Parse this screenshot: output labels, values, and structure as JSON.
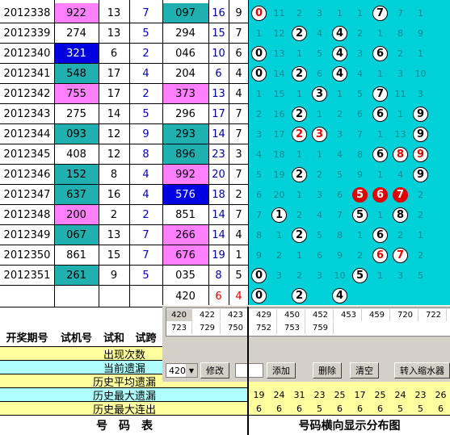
{
  "rows": [
    {
      "period": "2012338",
      "trial": "922",
      "sum": "13",
      "span": "7",
      "num3": "097",
      "s2": "16",
      "k2": "9",
      "dist": [
        "0",
        "11",
        "2",
        "3",
        "1",
        "1",
        "7",
        "7",
        "1"
      ]
    },
    {
      "period": "2012339",
      "trial": "274",
      "sum": "13",
      "span": "5",
      "num3": "294",
      "s2": "15",
      "k2": "7",
      "dist": [
        "1",
        "12",
        "2",
        "4",
        "4",
        "2",
        "1",
        "8",
        "9"
      ]
    },
    {
      "period": "2012340",
      "trial": "321",
      "sum": "6",
      "span": "2",
      "num3": "046",
      "s2": "10",
      "k2": "6",
      "dist": [
        "0",
        "13",
        "1",
        "5",
        "4",
        "3",
        "6",
        "2",
        "1"
      ]
    },
    {
      "period": "2012341",
      "trial": "548",
      "sum": "17",
      "span": "4",
      "num3": "204",
      "s2": "6",
      "k2": "4",
      "dist": [
        "0",
        "14",
        "2",
        "6",
        "4",
        "4",
        "1",
        "3",
        "10"
      ]
    },
    {
      "period": "2012342",
      "trial": "755",
      "sum": "17",
      "span": "2",
      "num3": "373",
      "s2": "13",
      "k2": "4",
      "dist": [
        "1",
        "15",
        "1",
        "3",
        "1",
        "5",
        "7",
        "11",
        "3"
      ]
    },
    {
      "period": "2012343",
      "trial": "275",
      "sum": "14",
      "span": "5",
      "num3": "296",
      "s2": "17",
      "k2": "7",
      "dist": [
        "2",
        "16",
        "2",
        "1",
        "2",
        "6",
        "6",
        "1",
        "9"
      ]
    },
    {
      "period": "2012344",
      "trial": "093",
      "sum": "12",
      "span": "9",
      "num3": "293",
      "s2": "14",
      "k2": "7",
      "dist": [
        "3",
        "17",
        "2",
        "3",
        "3",
        "7",
        "1",
        "13",
        "9"
      ]
    },
    {
      "period": "2012345",
      "trial": "408",
      "sum": "12",
      "span": "8",
      "num3": "896",
      "s2": "23",
      "k2": "3",
      "dist": [
        "4",
        "18",
        "1",
        "1",
        "4",
        "8",
        "6",
        "8",
        "9"
      ]
    },
    {
      "period": "2012346",
      "trial": "152",
      "sum": "8",
      "span": "4",
      "num3": "992",
      "s2": "20",
      "k2": "7",
      "dist": [
        "5",
        "19",
        "2",
        "2",
        "5",
        "9",
        "1",
        "4",
        "9"
      ]
    },
    {
      "period": "2012347",
      "trial": "637",
      "sum": "16",
      "span": "4",
      "num3": "576",
      "s2": "18",
      "k2": "2",
      "dist": [
        "6",
        "20",
        "1",
        "3",
        "6",
        "5",
        "6",
        "7",
        "2"
      ]
    },
    {
      "period": "2012348",
      "trial": "200",
      "sum": "2",
      "span": "2",
      "num3": "851",
      "s2": "14",
      "k2": "7",
      "dist": [
        "7",
        "1",
        "2",
        "4",
        "7",
        "5",
        "1",
        "8",
        "2"
      ]
    },
    {
      "period": "2012349",
      "trial": "067",
      "sum": "13",
      "span": "7",
      "num3": "266",
      "s2": "14",
      "k2": "4",
      "dist": [
        "8",
        "1",
        "2",
        "5",
        "8",
        "1",
        "6",
        "2",
        "1"
      ]
    },
    {
      "period": "2012350",
      "trial": "861",
      "sum": "15",
      "span": "7",
      "num3": "676",
      "s2": "19",
      "k2": "1",
      "dist": [
        "9",
        "2",
        "1",
        "6",
        "9",
        "2",
        "6",
        "7",
        "2"
      ]
    },
    {
      "period": "2012351",
      "trial": "261",
      "sum": "9",
      "span": "5",
      "num3": "035",
      "s2": "8",
      "k2": "5",
      "dist": [
        "0",
        "3",
        "2",
        "3",
        "10",
        "5",
        "1",
        "3",
        "5"
      ]
    }
  ],
  "next_row": {
    "num3": "420",
    "s2": "6",
    "k2": "4",
    "dist": [
      "0",
      "",
      "2",
      "",
      "4",
      "",
      "",
      "",
      ""
    ]
  },
  "headers": {
    "period": "开奖期号",
    "trial": "试机号",
    "sum": "试和",
    "span": "试跨"
  },
  "stats_labels": [
    "出现次数",
    "当前遗漏",
    "历史平均遗漏",
    "历史最大遗漏",
    "历史最大连出"
  ],
  "stats_rows": [
    [
      "19",
      "24",
      "31",
      "23",
      "25",
      "17",
      "25",
      "24",
      "23",
      "26"
    ],
    [
      "6",
      "6",
      "6",
      "5",
      "6",
      "6",
      "6",
      "5",
      "5",
      "6"
    ]
  ],
  "panel": {
    "list_row1": [
      "420",
      "422",
      "423",
      "429",
      "450",
      "452",
      "453",
      "459",
      "720",
      "722"
    ],
    "list_row2": [
      "723",
      "729",
      "750",
      "752",
      "753",
      "759"
    ],
    "select_value": "420",
    "btn_modify": "修改",
    "btn_add": "添加",
    "btn_delete": "删除",
    "btn_clear": "清空",
    "btn_shrink": "转入缩水器"
  },
  "footer": {
    "left": "号　码　表",
    "right": "号码横向显示分布图"
  },
  "colors": {
    "cyan": "#00d0d8",
    "pink": "#ff80ff",
    "teal": "#20b0b0",
    "blue": "#0000e0",
    "yellow": "#ffffa0"
  }
}
